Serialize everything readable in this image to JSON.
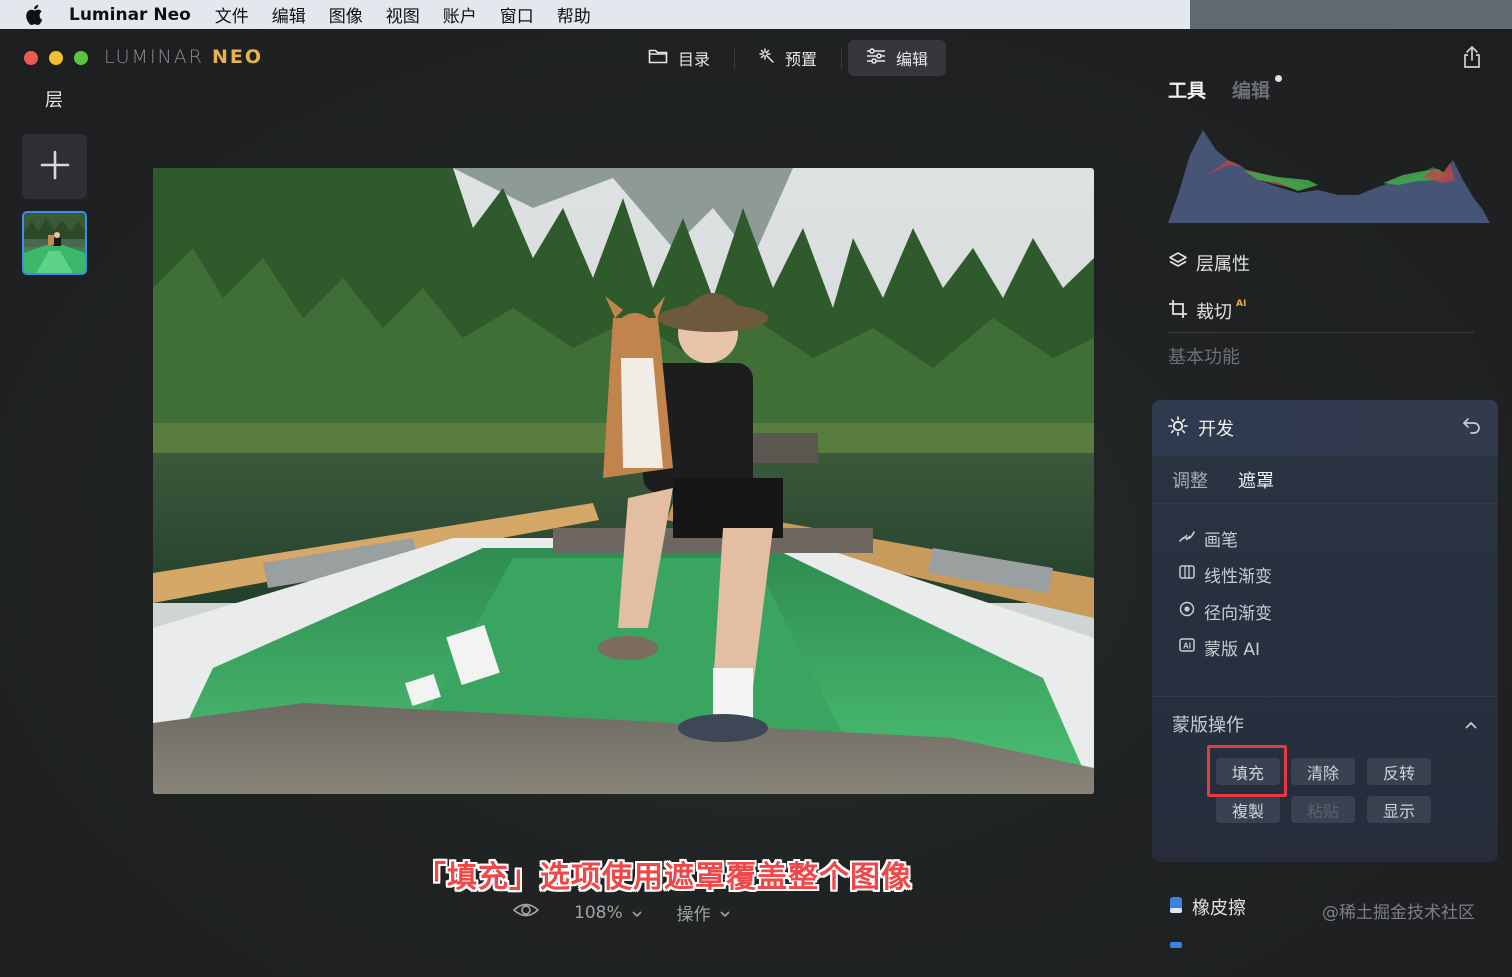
{
  "menubar": {
    "app_name": "Luminar Neo",
    "items": [
      "文件",
      "编辑",
      "图像",
      "视图",
      "账户",
      "窗口",
      "帮助"
    ]
  },
  "window": {
    "brand_main": "LUMINAR",
    "brand_accent": "NEO",
    "modes": [
      {
        "label": "目录",
        "icon": "folder-icon"
      },
      {
        "label": "预置",
        "icon": "sparkle-icon"
      },
      {
        "label": "编辑",
        "icon": "sliders-icon",
        "active": true
      }
    ]
  },
  "layers_panel": {
    "title": "层"
  },
  "canvas": {
    "caption": "「填充」选项使用遮罩覆盖整个图像",
    "zoom": "108%",
    "actions_label": "操作"
  },
  "right_panel": {
    "tabs": {
      "tools": "工具",
      "edits": "编辑"
    },
    "layer_properties": "层属性",
    "crop": "裁切",
    "crop_badge": "AI",
    "section_basic": "基本功能",
    "develop": {
      "title": "开发",
      "subtabs": {
        "adjust": "调整",
        "mask": "遮罩"
      },
      "mask_tools": [
        {
          "label": "画笔",
          "icon": "brush-icon"
        },
        {
          "label": "线性渐变",
          "icon": "linear-gradient-icon"
        },
        {
          "label": "径向渐变",
          "icon": "radial-gradient-icon"
        },
        {
          "label": "蒙版 AI",
          "icon": "mask-ai-icon"
        }
      ],
      "mask_ops_title": "蒙版操作",
      "ops": {
        "fill": "填充",
        "clear": "清除",
        "invert": "反转",
        "copy": "複製",
        "paste": "粘贴",
        "show": "显示"
      }
    },
    "eraser": "橡皮擦"
  },
  "watermark": "@稀土掘金技术社区",
  "colors": {
    "accent_blue": "#3e8de8",
    "brand_gold": "#e7b34d",
    "highlight_red": "#e43c3c"
  }
}
